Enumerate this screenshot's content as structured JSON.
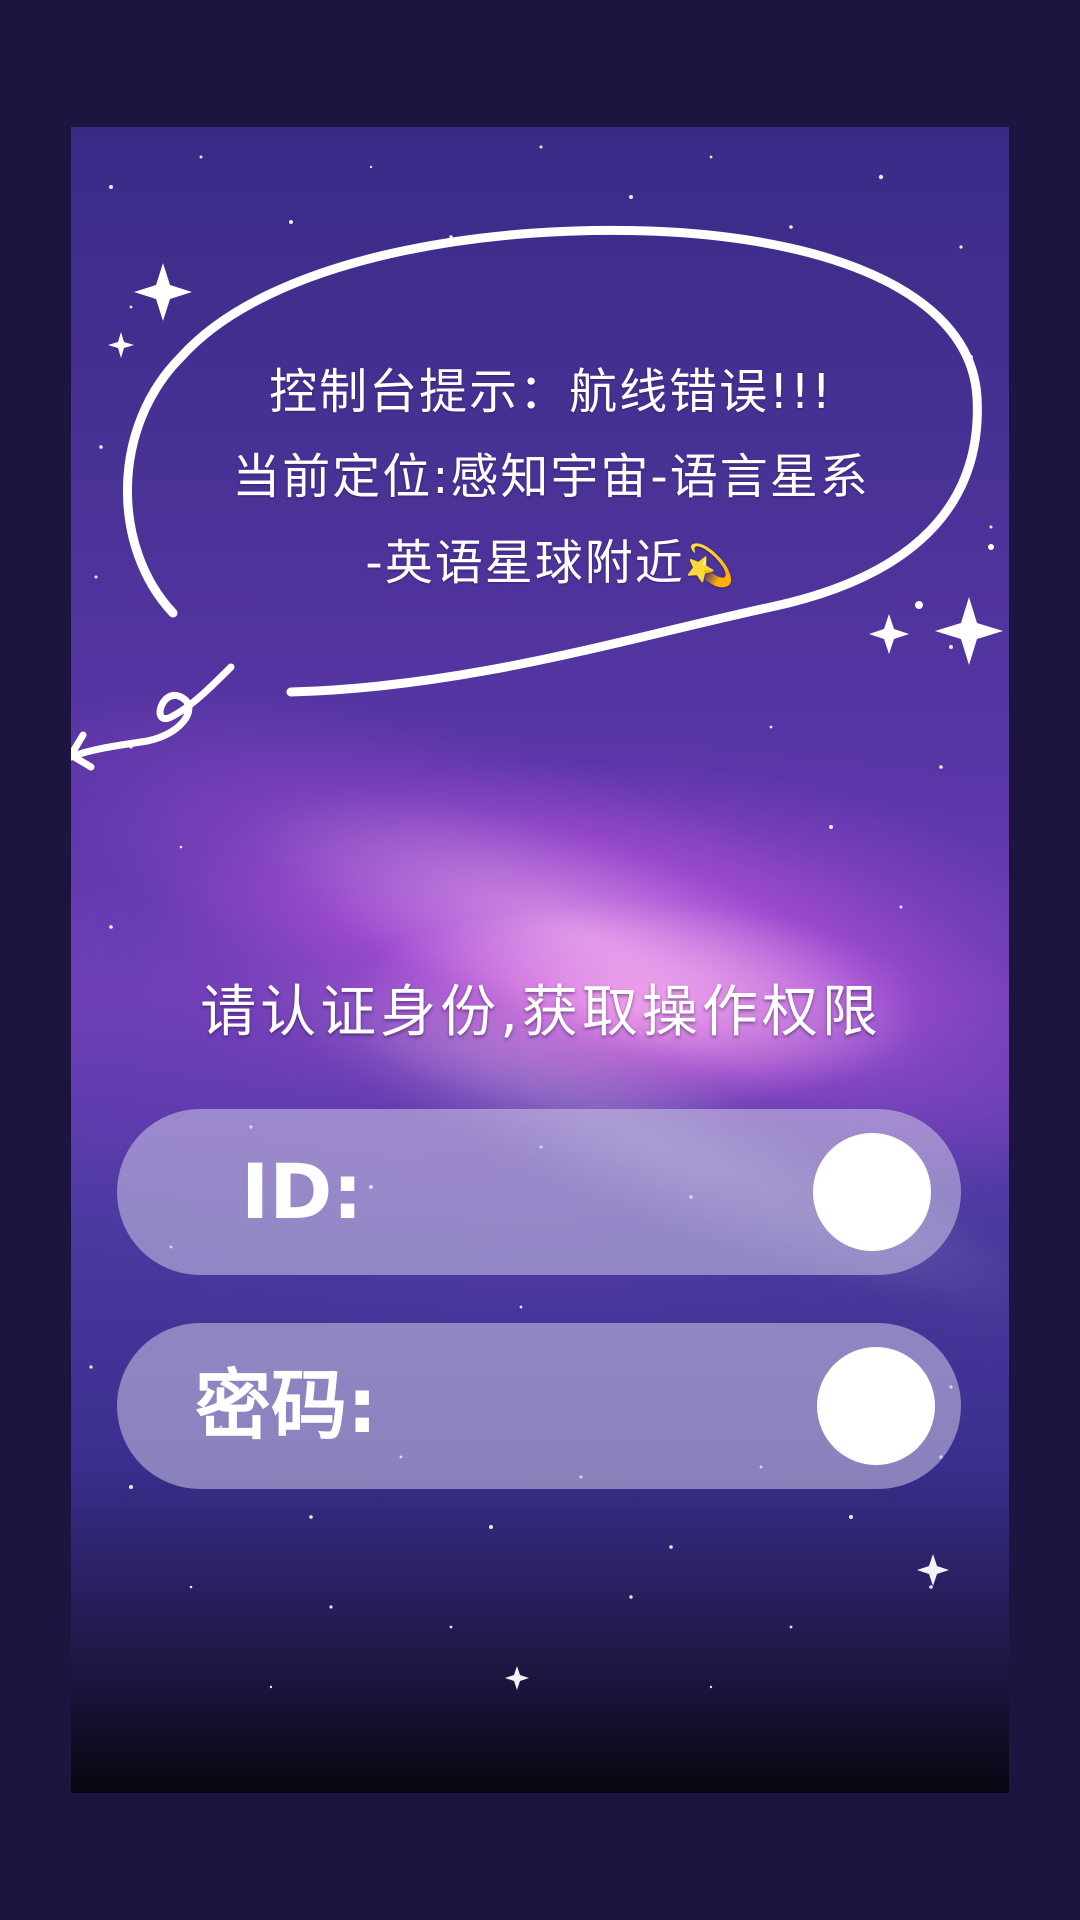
{
  "console": {
    "line1": "控制台提示：航线错误!!!",
    "line2": "当前定位:感知宇宙-语言星系",
    "line3": "-英语星球附近",
    "line3_emoji": "💫"
  },
  "prompt": "请认证身份,获取操作权限",
  "fields": {
    "id_label": "ID:",
    "password_label": "密码:"
  },
  "colors": {
    "page_background": "#1b1540",
    "field_fill": "rgba(205,200,230,0.55)",
    "text": "#ffffff"
  }
}
